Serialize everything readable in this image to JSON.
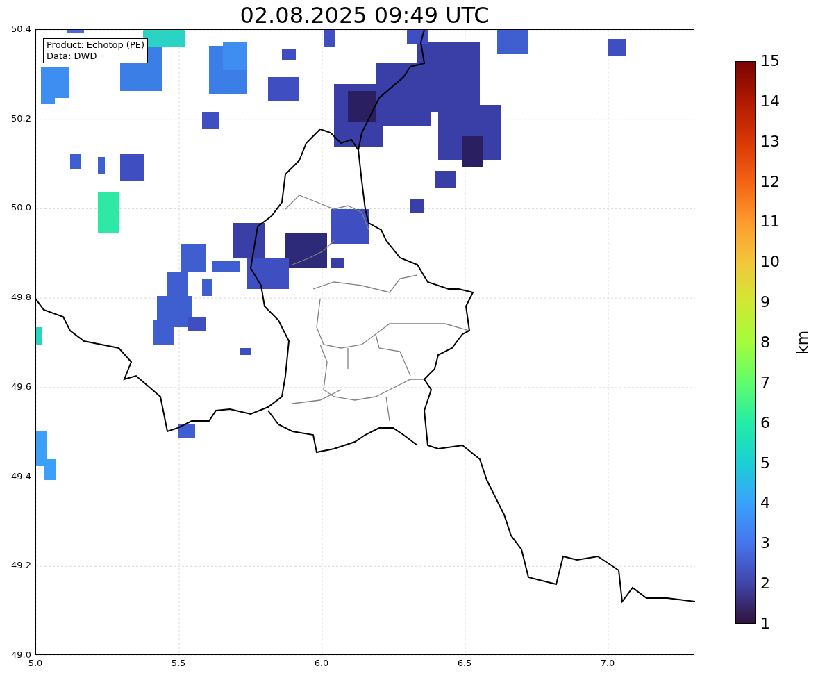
{
  "title": "02.08.2025 09:49 UTC",
  "info_box": {
    "lines": [
      "Product: Echotop (PE)",
      "Data: DWD"
    ]
  },
  "axes": {
    "xticks": [
      "5.0",
      "5.5",
      "6.0",
      "6.5",
      "7.0"
    ],
    "yticks": [
      "50.4",
      "50.2",
      "50.0",
      "49.8",
      "49.6",
      "49.4",
      "49.2",
      "49.0"
    ]
  },
  "colorbar": {
    "label": "km",
    "ticks": [
      "15",
      "14",
      "13",
      "12",
      "11",
      "10",
      "9",
      "8",
      "7",
      "6",
      "5",
      "4",
      "3",
      "2",
      "1"
    ]
  }
}
